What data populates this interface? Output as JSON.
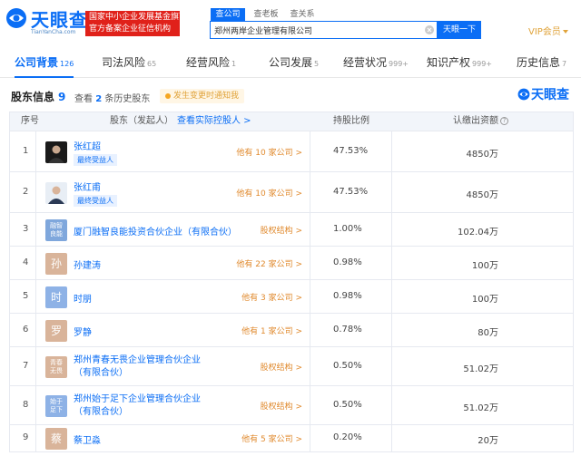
{
  "header": {
    "logo_text": "天眼查",
    "logo_url": "TianYanCha.com",
    "badge_line1": "国家中小企业发展基金旗下",
    "badge_line2": "官方备案企业征信机构",
    "search_tabs": [
      "查公司",
      "查老板",
      "查关系"
    ],
    "search_value": "郑州两岸企业管理有限公司",
    "search_button": "天眼一下",
    "vip": "VIP会员"
  },
  "nav": {
    "tabs": [
      {
        "label": "公司背景",
        "count": "126",
        "active": true
      },
      {
        "label": "司法风险",
        "count": "65"
      },
      {
        "label": "经营风险",
        "count": "1"
      },
      {
        "label": "公司发展",
        "count": "5"
      },
      {
        "label": "经营状况",
        "count": "999+"
      },
      {
        "label": "知识产权",
        "count": "999+"
      },
      {
        "label": "历史信息",
        "count": "7"
      }
    ]
  },
  "section": {
    "title": "股东信息",
    "count": "9",
    "history_prefix": "查看",
    "history_count": "2",
    "history_suffix": "条历史股东",
    "note": "发生变更时通知我",
    "watermark": "天眼查"
  },
  "table": {
    "headers": {
      "index": "序号",
      "shareholder": "股东（发起人）",
      "controller_link": "查看实际控股人 >",
      "ratio": "持股比例",
      "capital": "认缴出资额"
    },
    "rows": [
      {
        "index": "1",
        "avatar_type": "photo",
        "name": "张红超",
        "tag": "最终受益人",
        "relation": "他有 10 家公司 >",
        "ratio": "47.53%",
        "capital": "4850万"
      },
      {
        "index": "2",
        "avatar_type": "photo",
        "name": "张红甫",
        "tag": "最终受益人",
        "relation": "他有 10 家公司 >",
        "ratio": "47.53%",
        "capital": "4850万"
      },
      {
        "index": "3",
        "avatar_type": "dual",
        "avatar_line1": "融智",
        "avatar_line2": "良能",
        "avatar_color": "#7fa7dc",
        "name": "厦门融智良能投资合伙企业（有限合伙）",
        "relation": "股权结构 >",
        "ratio": "1.00%",
        "capital": "102.04万"
      },
      {
        "index": "4",
        "avatar_type": "char",
        "avatar_char": "孙",
        "avatar_color": "#d9b49a",
        "name": "孙建涛",
        "relation": "他有 22 家公司 >",
        "ratio": "0.98%",
        "capital": "100万"
      },
      {
        "index": "5",
        "avatar_type": "char",
        "avatar_char": "时",
        "avatar_color": "#8eb2e6",
        "name": "时朋",
        "relation": "他有 3 家公司 >",
        "ratio": "0.98%",
        "capital": "100万"
      },
      {
        "index": "6",
        "avatar_type": "char",
        "avatar_char": "罗",
        "avatar_color": "#d9b49a",
        "name": "罗静",
        "relation": "他有 1 家公司 >",
        "ratio": "0.78%",
        "capital": "80万"
      },
      {
        "index": "7",
        "avatar_type": "dual",
        "avatar_line1": "青春",
        "avatar_line2": "无畏",
        "avatar_color": "#d9b49a",
        "name": "郑州青春无畏企业管理合伙企业（有限合伙）",
        "relation": "股权结构 >",
        "ratio": "0.50%",
        "capital": "51.02万"
      },
      {
        "index": "8",
        "avatar_type": "dual",
        "avatar_line1": "始于",
        "avatar_line2": "足下",
        "avatar_color": "#8eb2e6",
        "name": "郑州始于足下企业管理合伙企业（有限合伙）",
        "relation": "股权结构 >",
        "ratio": "0.50%",
        "capital": "51.02万"
      },
      {
        "index": "9",
        "avatar_type": "char",
        "avatar_char": "蔡",
        "avatar_color": "#d9b49a",
        "name": "蔡卫淼",
        "relation": "他有 5 家公司 >",
        "ratio": "0.20%",
        "capital": "20万"
      }
    ]
  },
  "colors": {
    "brand": "#0b6ef5",
    "badge_red": "#e0211a",
    "relation_orange": "#e08a2e",
    "vip_gold": "#e0a33a"
  }
}
